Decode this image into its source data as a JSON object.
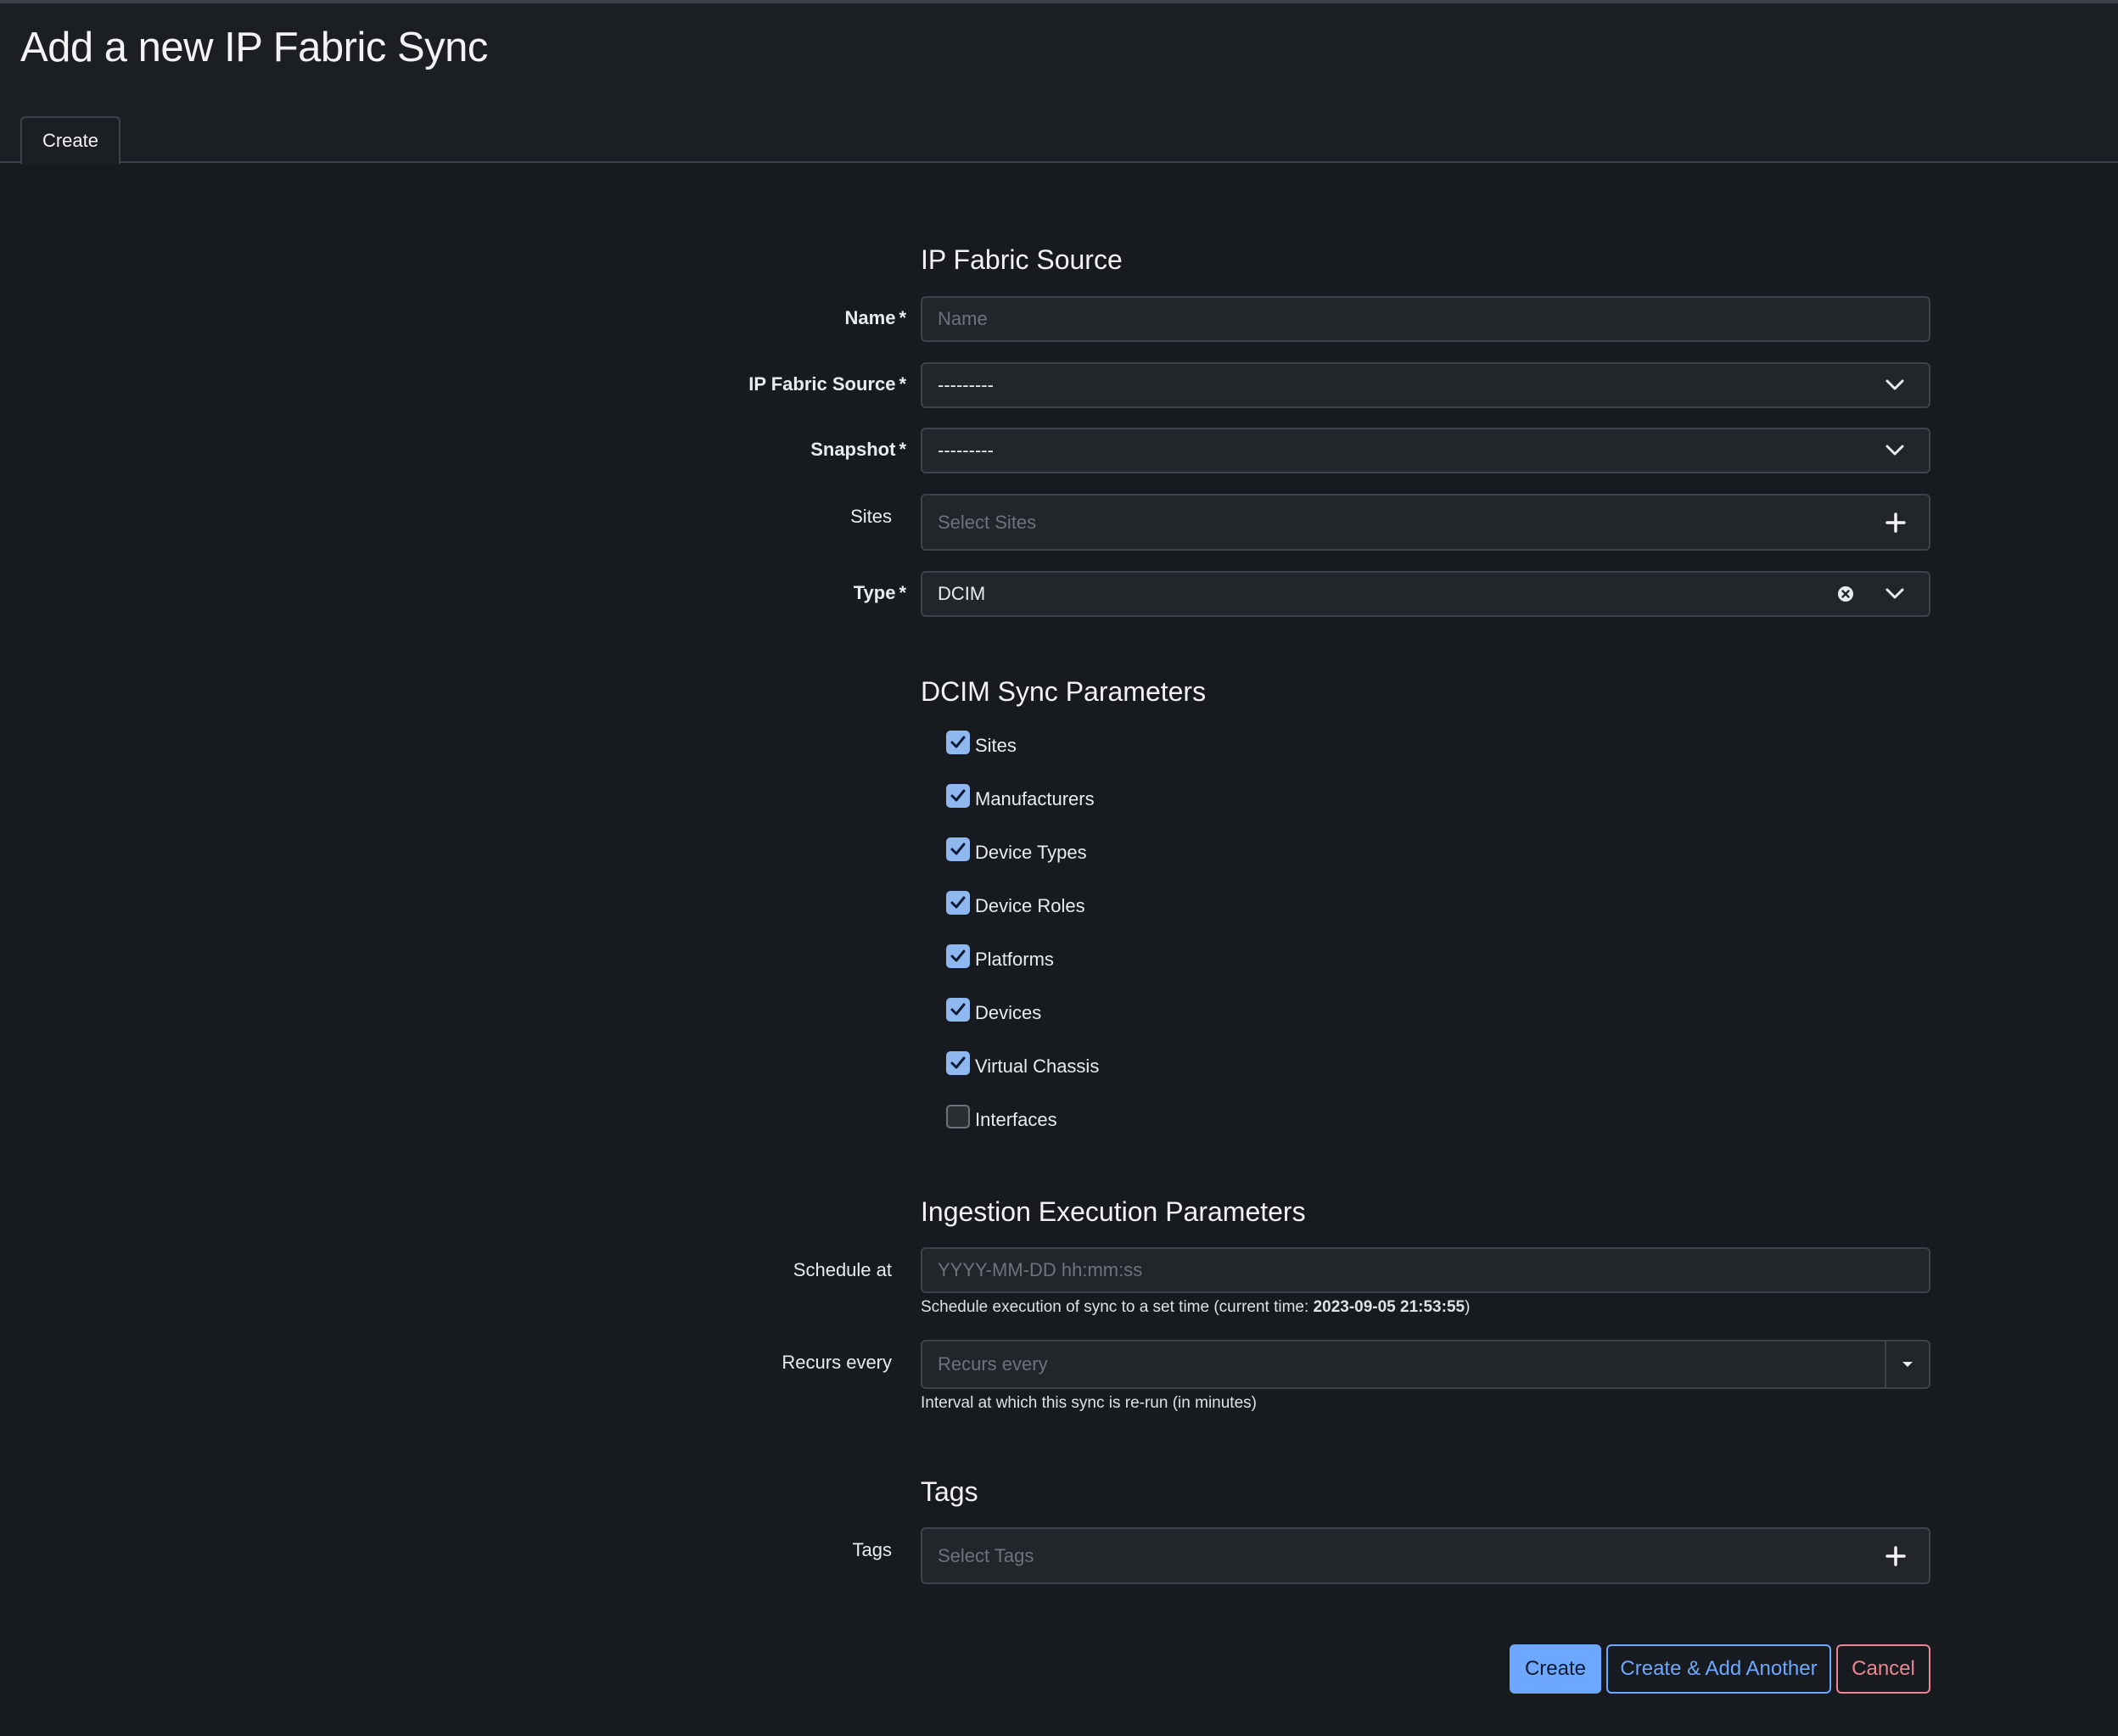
{
  "page": {
    "title": "Add a new IP Fabric Sync"
  },
  "tabs": [
    {
      "label": "Create"
    }
  ],
  "sections": {
    "source": {
      "title": "IP Fabric Source",
      "name": {
        "label": "Name",
        "placeholder": "Name"
      },
      "source": {
        "label": "IP Fabric Source",
        "value": "---------"
      },
      "snapshot": {
        "label": "Snapshot",
        "value": "---------"
      },
      "sites": {
        "label": "Sites",
        "placeholder": "Select Sites"
      },
      "type": {
        "label": "Type",
        "value": "DCIM"
      }
    },
    "dcim": {
      "title": "DCIM Sync Parameters",
      "items": [
        {
          "label": "Sites",
          "checked": true
        },
        {
          "label": "Manufacturers",
          "checked": true
        },
        {
          "label": "Device Types",
          "checked": true
        },
        {
          "label": "Device Roles",
          "checked": true
        },
        {
          "label": "Platforms",
          "checked": true
        },
        {
          "label": "Devices",
          "checked": true
        },
        {
          "label": "Virtual Chassis",
          "checked": true
        },
        {
          "label": "Interfaces",
          "checked": false
        }
      ]
    },
    "ingestion": {
      "title": "Ingestion Execution Parameters",
      "schedule": {
        "label": "Schedule at",
        "placeholder": "YYYY-MM-DD hh:mm:ss",
        "help_prefix": "Schedule execution of sync to a set time (current time: ",
        "help_time": "2023-09-05 21:53:55",
        "help_suffix": ")"
      },
      "recurs": {
        "label": "Recurs every",
        "placeholder": "Recurs every",
        "help": "Interval at which this sync is re-run (in minutes)"
      }
    },
    "tags": {
      "title": "Tags",
      "field": {
        "label": "Tags",
        "placeholder": "Select Tags"
      }
    }
  },
  "actions": {
    "create": "Create",
    "create_another": "Create & Add Another",
    "cancel": "Cancel"
  },
  "required_marker": "*",
  "colors": {
    "background": "#171b1f",
    "field_bg": "#22262b",
    "primary": "#6ea8fe",
    "danger": "#ea868f",
    "checkbox_on": "#8fb8f0"
  },
  "icons": {
    "select_arrow": "chevron-down-icon",
    "add": "plus-icon",
    "clear": "clear-circle-icon",
    "check": "check-icon",
    "dropdown_caret": "caret-down-icon"
  }
}
